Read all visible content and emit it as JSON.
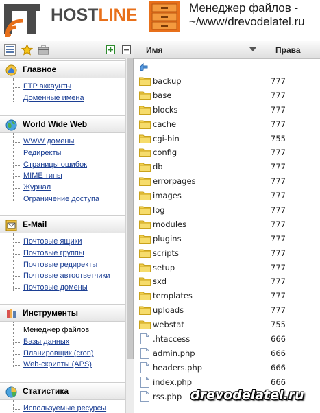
{
  "header": {
    "logo_host": "HOST",
    "logo_line": "LINE",
    "title_line1": "Менеджер файлов -",
    "title_line2": "~/www/drevodelatel.ru"
  },
  "left_toolbar": {
    "icons": [
      "list-icon",
      "star-icon",
      "briefcase-icon",
      "expand-icon",
      "collapse-icon"
    ]
  },
  "sections": [
    {
      "title": "Главное",
      "icon": "home-icon",
      "links": [
        "FTP аккаунты",
        "Доменные имена"
      ]
    },
    {
      "title": "World Wide Web",
      "icon": "globe-icon",
      "links": [
        "WWW домены",
        "Редиректы",
        "Страницы ошибок",
        "MIME типы",
        "Журнал",
        "Ограничение доступа"
      ]
    },
    {
      "title": "E-Mail",
      "icon": "mail-icon",
      "links": [
        "Почтовые ящики",
        "Почтовые группы",
        "Почтовые редиректы",
        "Почтовые автоответчики",
        "Почтовые домены"
      ]
    },
    {
      "title": "Инструменты",
      "icon": "tools-icon",
      "links": [
        "Менеджер файлов",
        "Базы данных",
        "Планировщик (cron)",
        "Web-скрипты (APS)"
      ]
    },
    {
      "title": "Статистика",
      "icon": "stats-icon",
      "links": [
        "Используемые ресурсы"
      ]
    }
  ],
  "file_table": {
    "col_name": "Имя",
    "col_rights": "Права",
    "rows": [
      {
        "name": "backup",
        "type": "folder",
        "perm": "777"
      },
      {
        "name": "base",
        "type": "folder",
        "perm": "777"
      },
      {
        "name": "blocks",
        "type": "folder",
        "perm": "777"
      },
      {
        "name": "cache",
        "type": "folder",
        "perm": "777"
      },
      {
        "name": "cgi-bin",
        "type": "folder",
        "perm": "755"
      },
      {
        "name": "config",
        "type": "folder",
        "perm": "777"
      },
      {
        "name": "db",
        "type": "folder",
        "perm": "777"
      },
      {
        "name": "errorpages",
        "type": "folder",
        "perm": "777"
      },
      {
        "name": "images",
        "type": "folder",
        "perm": "777"
      },
      {
        "name": "log",
        "type": "folder",
        "perm": "777"
      },
      {
        "name": "modules",
        "type": "folder",
        "perm": "777"
      },
      {
        "name": "plugins",
        "type": "folder",
        "perm": "777"
      },
      {
        "name": "scripts",
        "type": "folder",
        "perm": "777"
      },
      {
        "name": "setup",
        "type": "folder",
        "perm": "777"
      },
      {
        "name": "sxd",
        "type": "folder",
        "perm": "777"
      },
      {
        "name": "templates",
        "type": "folder",
        "perm": "777"
      },
      {
        "name": "uploads",
        "type": "folder",
        "perm": "777"
      },
      {
        "name": "webstat",
        "type": "folder",
        "perm": "755"
      },
      {
        "name": ".htaccess",
        "type": "file",
        "perm": "666"
      },
      {
        "name": "admin.php",
        "type": "file",
        "perm": "666"
      },
      {
        "name": "headers.php",
        "type": "file",
        "perm": "666"
      },
      {
        "name": "index.php",
        "type": "file",
        "perm": "666"
      },
      {
        "name": "rss.php",
        "type": "file",
        "perm": ""
      }
    ]
  },
  "watermark": "drevodelatel.ru",
  "colors": {
    "logo_orange": "#e8701a",
    "link_blue": "#1c3f94",
    "folder_yellow": "#f2cf4a"
  }
}
